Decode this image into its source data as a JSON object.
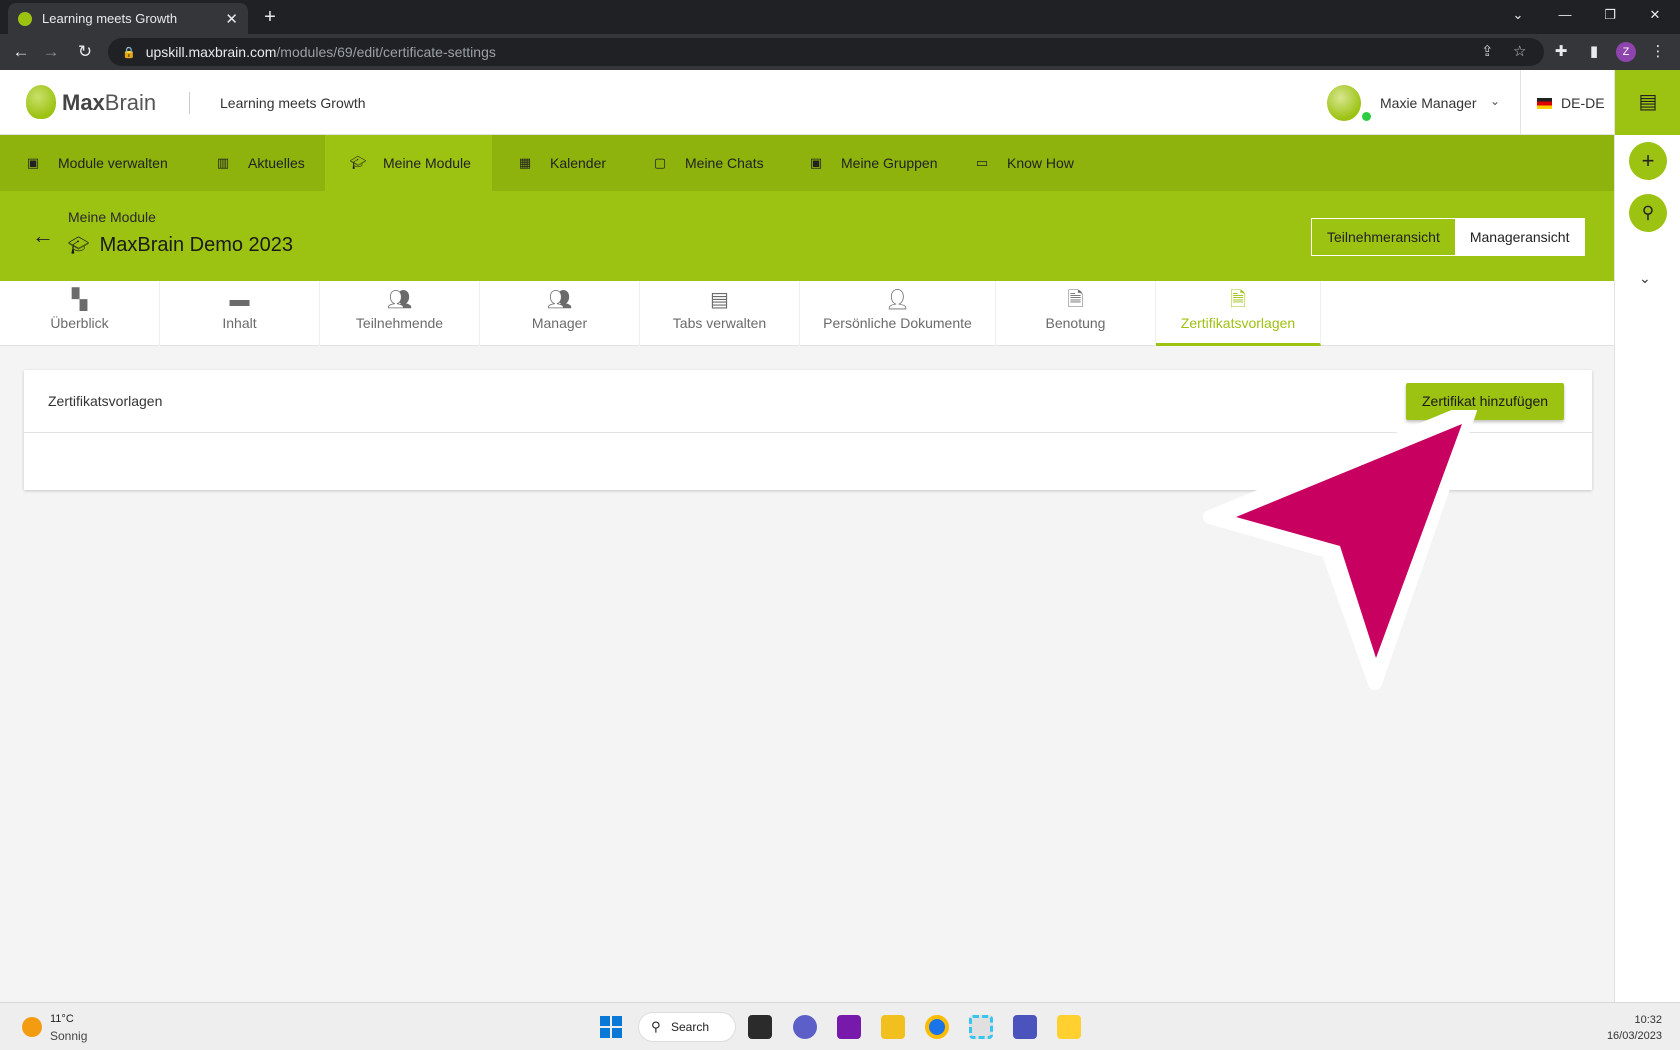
{
  "browser": {
    "tab_title": "Learning meets Growth",
    "url_host": "upskill.maxbrain.com",
    "url_path": "/modules/69/edit/certificate-settings",
    "profile_initial": "Z"
  },
  "header": {
    "logo_bold": "Max",
    "logo_light": "Brain",
    "tagline": "Learning meets Growth",
    "user_name": "Maxie Manager",
    "language": "DE-DE"
  },
  "nav": {
    "items": [
      {
        "label": "Module verwalten",
        "icon": "folder-user-icon"
      },
      {
        "label": "Aktuelles",
        "icon": "news-icon"
      },
      {
        "label": "Meine Module",
        "icon": "graduation-cap-icon"
      },
      {
        "label": "Kalender",
        "icon": "calendar-icon"
      },
      {
        "label": "Meine Chats",
        "icon": "chat-icon"
      },
      {
        "label": "Meine Gruppen",
        "icon": "group-icon"
      },
      {
        "label": "Know How",
        "icon": "book-icon"
      }
    ],
    "active": "Meine Module"
  },
  "module": {
    "breadcrumb": "Meine Module",
    "title": "MaxBrain Demo 2023",
    "view_participant": "Teilnehmeransicht",
    "view_manager": "Manageransicht"
  },
  "subtabs": {
    "items": [
      {
        "label": "Überblick",
        "icon": "dashboard-icon"
      },
      {
        "label": "Inhalt",
        "icon": "folder-icon"
      },
      {
        "label": "Teilnehmende",
        "icon": "people-icon"
      },
      {
        "label": "Manager",
        "icon": "manager-icon"
      },
      {
        "label": "Tabs verwalten",
        "icon": "window-icon"
      },
      {
        "label": "Persönliche Dokumente",
        "icon": "person-lock-icon"
      },
      {
        "label": "Benotung",
        "icon": "grade-document-icon"
      },
      {
        "label": "Zertifikatsvorlagen",
        "icon": "certificate-settings-icon"
      }
    ],
    "active": "Zertifikatsvorlagen"
  },
  "card": {
    "title": "Zertifikatsvorlagen",
    "add_button": "Zertifikat hinzufügen"
  },
  "taskbar": {
    "temperature": "11°C",
    "condition": "Sonnig",
    "search_label": "Search",
    "time": "10:32",
    "date": "16/03/2023"
  },
  "colors": {
    "brand_green": "#9cc212",
    "nav_green": "#8db30c",
    "annotation_arrow": "#c8005f"
  }
}
